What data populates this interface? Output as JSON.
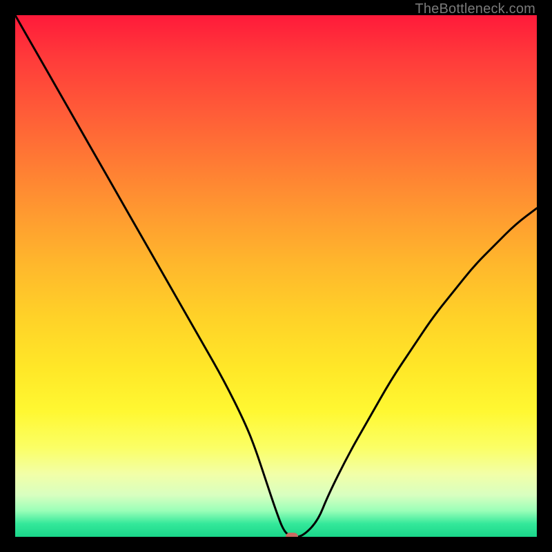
{
  "watermark": "TheBottleneck.com",
  "chart_data": {
    "type": "line",
    "title": "",
    "xlabel": "",
    "ylabel": "",
    "xlim": [
      0,
      100
    ],
    "ylim": [
      0,
      100
    ],
    "grid": false,
    "legend": false,
    "series": [
      {
        "name": "bottleneck-curve",
        "x": [
          0,
          4,
          8,
          12,
          16,
          20,
          24,
          28,
          32,
          36,
          40,
          44,
          46,
          48,
          50,
          51.5,
          53,
          55,
          58,
          60,
          64,
          68,
          72,
          76,
          80,
          84,
          88,
          92,
          96,
          100
        ],
        "y": [
          100,
          93,
          86,
          79,
          72,
          65,
          58,
          51,
          44,
          37,
          30,
          22,
          17,
          11,
          5,
          1,
          0,
          0,
          3,
          8,
          16,
          23,
          30,
          36,
          42,
          47,
          52,
          56,
          60,
          63
        ],
        "color": "#000000"
      }
    ],
    "marker": {
      "x": 53,
      "y": 0,
      "color": "#c96a62"
    },
    "background_gradient": {
      "top": "#ff1a3a",
      "bottom": "#1ad68a",
      "stops": [
        "#ff1a3a",
        "#ff7a34",
        "#ffd228",
        "#fff832",
        "#d8ffc0",
        "#1ad68a"
      ]
    }
  }
}
